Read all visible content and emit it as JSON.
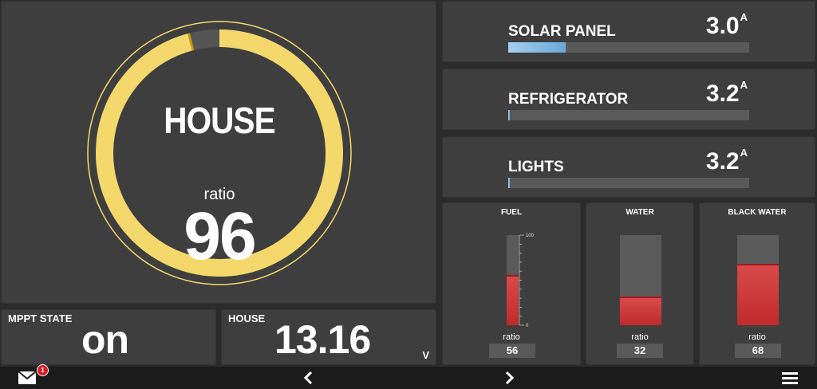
{
  "gauge": {
    "title": "HOUSE",
    "unit": "ratio",
    "value": "96",
    "fraction": 0.96,
    "colors": {
      "fill": "#f5d86b",
      "track": "#555555",
      "marker": "#c89a10"
    }
  },
  "mppt": {
    "label": "MPPT STATE",
    "value": "on"
  },
  "house_voltage": {
    "label": "HOUSE",
    "value": "13.16",
    "unit": "V"
  },
  "currents": [
    {
      "label": "SOLAR PANEL",
      "value": "3.0",
      "unit": "A",
      "fraction": 0.24
    },
    {
      "label": "REFRIGERATOR",
      "value": "3.2",
      "unit": "A",
      "fraction": 0.006
    },
    {
      "label": "LIGHTS",
      "value": "3.2",
      "unit": "A",
      "fraction": 0.006
    }
  ],
  "tanks": [
    {
      "title": "FUEL",
      "unit": "ratio",
      "value": "56",
      "fraction": 0.56,
      "scale_max": "100",
      "scale_min": "0"
    },
    {
      "title": "WATER",
      "unit": "ratio",
      "value": "32",
      "fraction": 0.32
    },
    {
      "title": "BLACK WATER",
      "unit": "ratio",
      "value": "68",
      "fraction": 0.68
    }
  ],
  "notifications": {
    "count": "1"
  },
  "nav": {
    "icons": [
      "mail-icon",
      "chevron-left-icon",
      "chevron-right-icon",
      "menu-icon"
    ]
  },
  "colors": {
    "background": "#2b2b2b",
    "panel": "#3e3e3e",
    "accent_blue": "#6aa8d8",
    "accent_red": "#c02a2a",
    "accent_yellow": "#f5d86b"
  }
}
